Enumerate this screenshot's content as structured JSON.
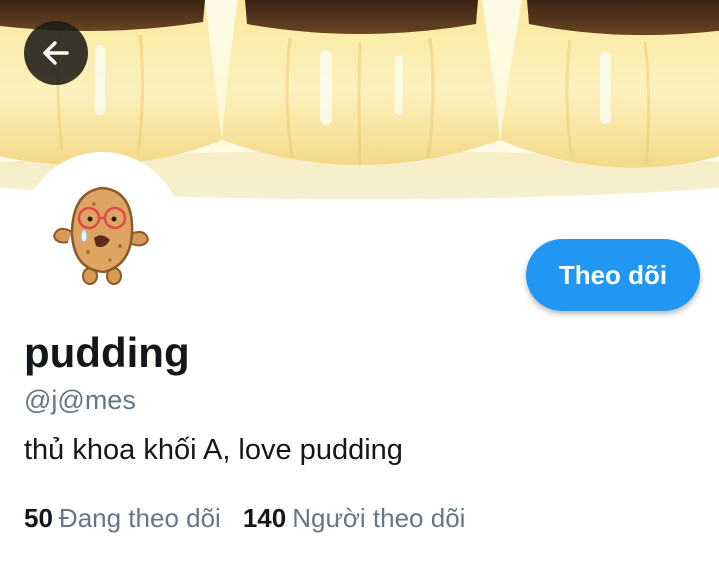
{
  "header": {
    "back_icon": "arrow-left-icon",
    "banner_image": "caramel-pudding-banner",
    "back_button_color": "#1e1b16"
  },
  "profile": {
    "avatar_image": "cartoon-potato-avatar",
    "name": "pudding",
    "handle": "@j@mes",
    "bio": "thủ khoa khối A, love pudding",
    "follow_label": "Theo dõi",
    "accent_color": "#2196f3"
  },
  "stats": {
    "following_count": "50",
    "following_label": "Đang theo dõi",
    "followers_count": "140",
    "followers_label": "Người theo dõi"
  }
}
